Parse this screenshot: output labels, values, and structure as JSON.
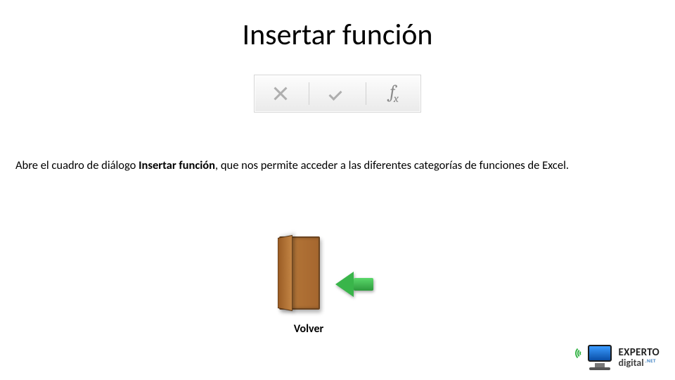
{
  "title": "Insertar función",
  "toolbar": {
    "cancel": "x-icon",
    "confirm": "check-icon",
    "fx": "fx-icon"
  },
  "description": {
    "pre": "Abre el cuadro de diálogo ",
    "bold": "Insertar función",
    "post": ", que nos permite acceder a las diferentes categorías de funciones de Excel."
  },
  "back": {
    "label": "Volver"
  },
  "logo": {
    "line1": "EXPERTO",
    "line2": "digital",
    "suffix": ".NET"
  }
}
